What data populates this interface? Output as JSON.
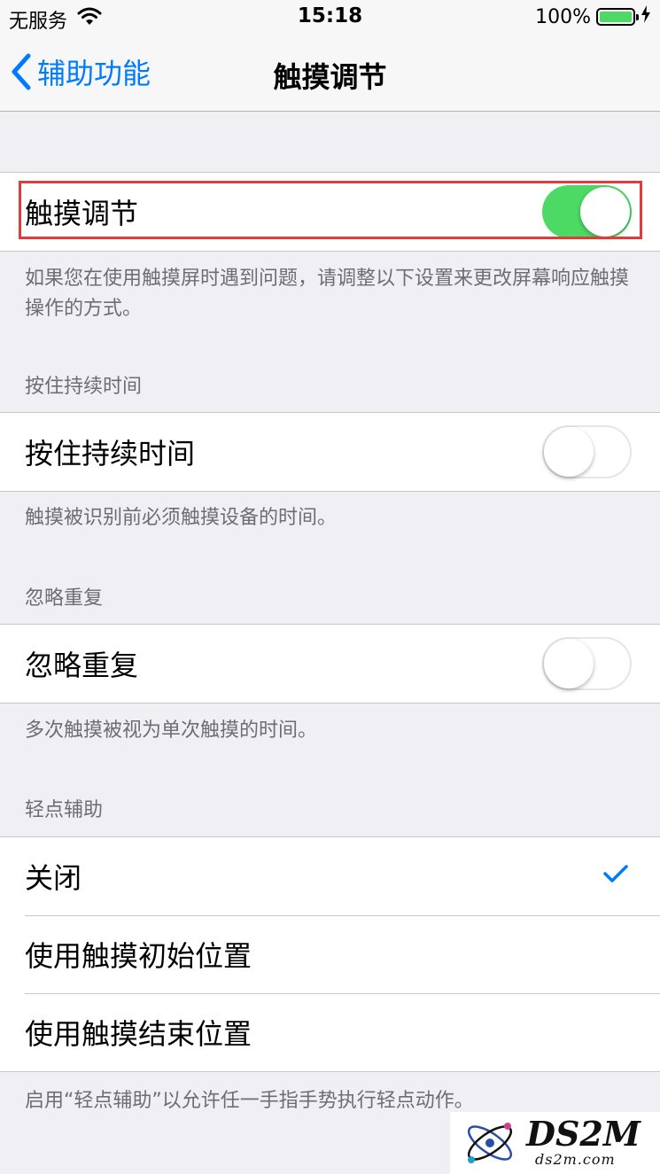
{
  "status": {
    "carrier": "无服务",
    "time": "15:18",
    "battery": "100%",
    "icons": [
      "wifi-icon",
      "battery-icon",
      "charging-icon"
    ]
  },
  "nav": {
    "back_label": "辅助功能",
    "title": "触摸调节"
  },
  "touch_accommodations": {
    "label": "触摸调节",
    "enabled": true,
    "footer": "如果您在使用触摸屏时遇到问题，请调整以下设置来更改屏幕响应触摸操作的方式。"
  },
  "hold_duration": {
    "header": "按住持续时间",
    "label": "按住持续时间",
    "enabled": false,
    "footer": "触摸被识别前必须触摸设备的时间。"
  },
  "ignore_repeat": {
    "header": "忽略重复",
    "label": "忽略重复",
    "enabled": false,
    "footer": "多次触摸被视为单次触摸的时间。"
  },
  "tap_assistance": {
    "header": "轻点辅助",
    "options": [
      "关闭",
      "使用触摸初始位置",
      "使用触摸结束位置"
    ],
    "selected": "关闭",
    "footer": "启用“轻点辅助”以允许任一手指手势执行轻点动作。"
  },
  "watermark": {
    "text": "DS2M",
    "sub": "ds2m.com"
  },
  "colors": {
    "accent": "#007aff",
    "toggle_on": "#4cd964",
    "highlight": "#e03c3c",
    "background": "#efeff4"
  }
}
